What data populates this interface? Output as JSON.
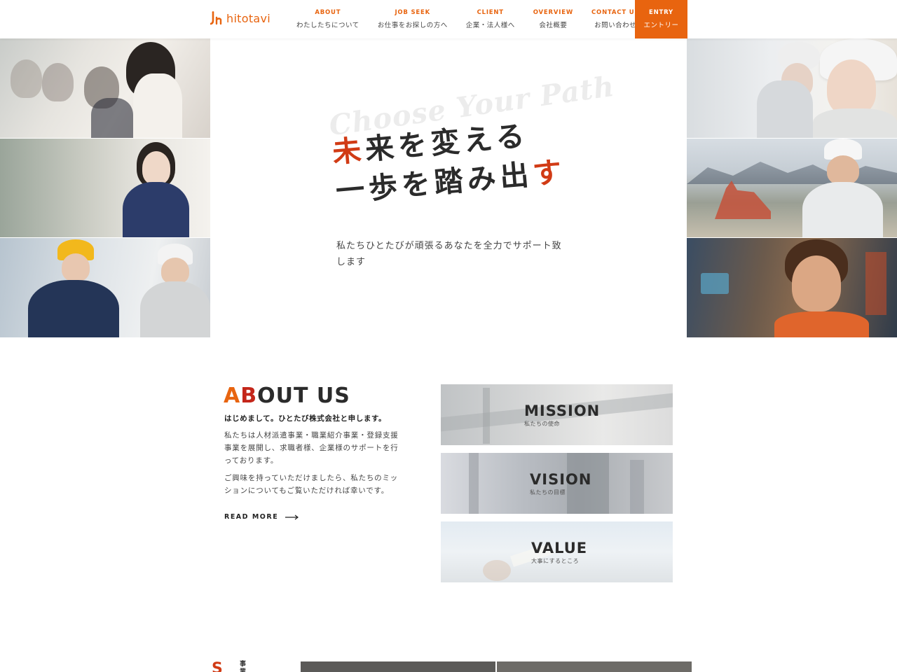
{
  "header": {
    "logo_text": "hitotavi",
    "brand_color": "#e8640f",
    "nav": [
      {
        "en": "ABOUT",
        "ja": "わたしたちについて"
      },
      {
        "en": "JOB SEEK",
        "ja": "お仕事をお探しの方へ"
      },
      {
        "en": "CLIENT",
        "ja": "企業・法人様へ"
      },
      {
        "en": "OVERVIEW",
        "ja": "会社概要"
      },
      {
        "en": "CONTACT US",
        "ja": "お問い合わせ"
      }
    ],
    "entry": {
      "en": "ENTRY",
      "ja": "エントリー"
    }
  },
  "hero": {
    "script_text": "Choose Your Path",
    "line1_accent": "未",
    "line1_rest": "来を変える",
    "line2_rest": "一歩を踏み出",
    "line2_accent": "す",
    "accent_color": "#d13b15",
    "subtitle": "私たちひとたびが頑張るあなたを全力でサポート致します"
  },
  "about": {
    "title_part1": "A",
    "title_part2": "B",
    "title_part3": "OUT US",
    "lead": "はじめまして。ひとたび株式会社と申します。",
    "paragraph1": "私たちは人材派遣事業・職業紹介事業・登録支援事業を展開し、求職者様、企業様のサポートを行っております。",
    "paragraph2": "ご興味を持っていただけましたら、私たちのミッションについてもご覧いただければ幸いです。",
    "read_more": "READ MORE",
    "cards": [
      {
        "title": "MISSION",
        "sub": "私たちの使命"
      },
      {
        "title": "VISION",
        "sub": "私たちの目標"
      },
      {
        "title": "VALUE",
        "sub": "大事にするところ"
      }
    ]
  },
  "bottom": {
    "mark": "S",
    "label": "事業"
  }
}
